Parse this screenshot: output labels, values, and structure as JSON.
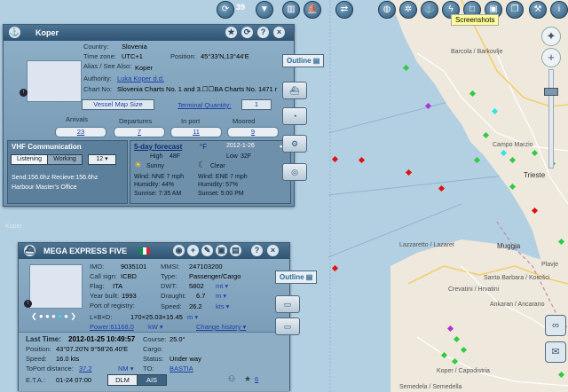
{
  "toolbar": {
    "counter": "39",
    "screenshots_label": "Screenshots"
  },
  "map": {
    "labels": {
      "barcola": "Barcola / Barkovlje",
      "campo_marzio": "Campo Marzio",
      "trieste": "Trieste",
      "lazzaretto": "Lazzaretto / Lazaret",
      "muggia": "Muggia",
      "santa_barbara": "Santa Barbara / Korošci",
      "plavje": "Plavje",
      "crevatini": "Crevatini / Hrvatini",
      "ankaran": "Ankaran / Ancarano",
      "koper": "Koper / Capodistria",
      "semedela": "Semedela / Semedella",
      "koper_left": "Koper"
    }
  },
  "port_panel": {
    "title": "Koper",
    "country_label": "Country:",
    "country": "Slovenia",
    "timezone_label": "Time zone:",
    "timezone": "UTC+1",
    "position_label": "Position:",
    "position": "45°33'N,13°44'E",
    "alias_label": "Alias / See Also:",
    "alias": "Koper",
    "authority_label": "Authority:",
    "authority": "Luka Koper d.d.",
    "chart_label": "Chart No:",
    "chart": "Slovenia Charts No. 1 and 3.☐☐BA Charts No. 1471 r",
    "vessel_map_btn": "Vessel Map Size",
    "terminal_label": "Terminal Quantity:",
    "terminal_value": "1",
    "stats": [
      {
        "label": "Arrivals",
        "value": "23"
      },
      {
        "label": "Departures",
        "value": "7"
      },
      {
        "label": "In port",
        "value": "11"
      },
      {
        "label": "Moored",
        "value": "9"
      }
    ],
    "vhf": {
      "title": "VHF Communication",
      "tab_listening": "Listening",
      "tab_working": "Working",
      "channel": "12",
      "send": "Send:156.6hz Recieve:156.6hz",
      "office": "Harbour Master's Office"
    },
    "weather": {
      "title": "5-day forecast",
      "unit": "°F",
      "date": "2012-1-26",
      "today": {
        "high_label": "High",
        "high": "48F",
        "cond": "Sunny",
        "wind": "Wind: NNE 7 mph",
        "humidity": "Humidity: 44%",
        "sunrise": "Sunrise: 7:35 AM"
      },
      "tonight": {
        "low_label": "Low",
        "low": "32F",
        "cond": "Clear",
        "wind": "Wind: ENE 7 mph",
        "humidity": "Humidity: 57%",
        "sunset": "Sunset: 5:00 PM"
      }
    }
  },
  "outline_label": "Outline",
  "vessel_panel": {
    "title": "MEGA EXPRESS FIVE",
    "flag_colors": [
      "#009246",
      "#ffffff",
      "#ce2b37"
    ],
    "imo_label": "IMO:",
    "imo": "9035101",
    "mmsi_label": "MMSI:",
    "mmsi": "247103200",
    "callsign_label": "Call sign:",
    "callsign": "ICBD",
    "type_label": "Type:",
    "type": "Passenger/Cargo",
    "flag_label": "Flag:",
    "flag": "ITA",
    "dwt_label": "DWT:",
    "dwt": "5802",
    "dwt_unit": "mt",
    "year_label": "Year built:",
    "year": "1993",
    "draught_label": "Draught:",
    "draught": "6.7",
    "draught_unit": "m",
    "registry_label": "Port of registry:",
    "speed_label": "Speed:",
    "speed_top": "26.2",
    "speed_unit": "kts",
    "dims_label": "L×B×D:",
    "dims": "170×25.03×15.45",
    "dims_unit": "m",
    "power": "Power:61168.0",
    "power_unit": "kW",
    "change_history": "Change history",
    "last_time_label": "Last Time:",
    "last_time": "2012-01-25 10:49:57",
    "course_label": "Course:",
    "course": "25.0°",
    "position_label": "Position:",
    "position": "43°07.20'N 9°58'26.40'E",
    "cargo_label": "Cargo:",
    "speed2_label": "Speed:",
    "speed2": "16.0 kts",
    "status_label": "Status:",
    "status": "Under way",
    "toport_label": "ToPort distance:",
    "toport": "37.2",
    "toport_unit": "NM",
    "to_label": "TO:",
    "to": "BASTIA",
    "eta_label": "E.T.A.:",
    "eta": "01-24 07:00",
    "tab_dlm": "DLM",
    "tab_ais": "AIS",
    "star_count": "6"
  }
}
